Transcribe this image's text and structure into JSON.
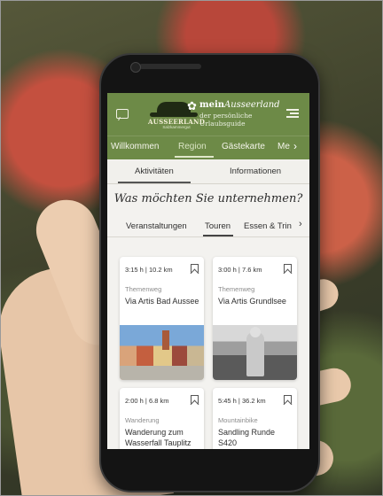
{
  "app": {
    "logo_text": "AUSSEERLAND",
    "logo_sub": "Salzkammergut",
    "brand_bold": "mein",
    "brand_script": "Ausseerland",
    "brand_sub_1": "der persönliche",
    "brand_sub_2": "Urlaubsguide"
  },
  "icons": {
    "chat": "chat-icon",
    "menu": "menu-icon",
    "bookmark": "bookmark-icon",
    "chevron": "chevron-right-icon"
  },
  "nav": {
    "items": [
      "Willkommen",
      "Region",
      "Gästekarte",
      "Me"
    ],
    "active": "Region",
    "arrow": "›"
  },
  "subtabs": {
    "items": [
      "Aktivitäten",
      "Informationen"
    ],
    "active": "Aktivitäten"
  },
  "question": "Was möchten Sie unternehmen?",
  "categories": {
    "items": [
      "Veranstaltungen",
      "Touren",
      "Essen & Trin"
    ],
    "active": "Touren",
    "arrow": "›"
  },
  "cards": [
    {
      "meta": "3:15 h | 10.2 km",
      "type": "Themenweg",
      "title": "Via Artis Bad Aussee"
    },
    {
      "meta": "3:00 h | 7.6 km",
      "type": "Themenweg",
      "title": "Via Artis Grundlsee"
    },
    {
      "meta": "2:00 h | 6.8 km",
      "type": "Wanderung",
      "title": "Wanderung zum Wasserfall Tauplitz"
    },
    {
      "meta": "5:45 h | 36.2 km",
      "type": "Mountainbike",
      "title": "Sandling Runde S420"
    }
  ],
  "colors": {
    "brand_green": "#6d8a47",
    "screen_bg": "#f3f2ef"
  }
}
